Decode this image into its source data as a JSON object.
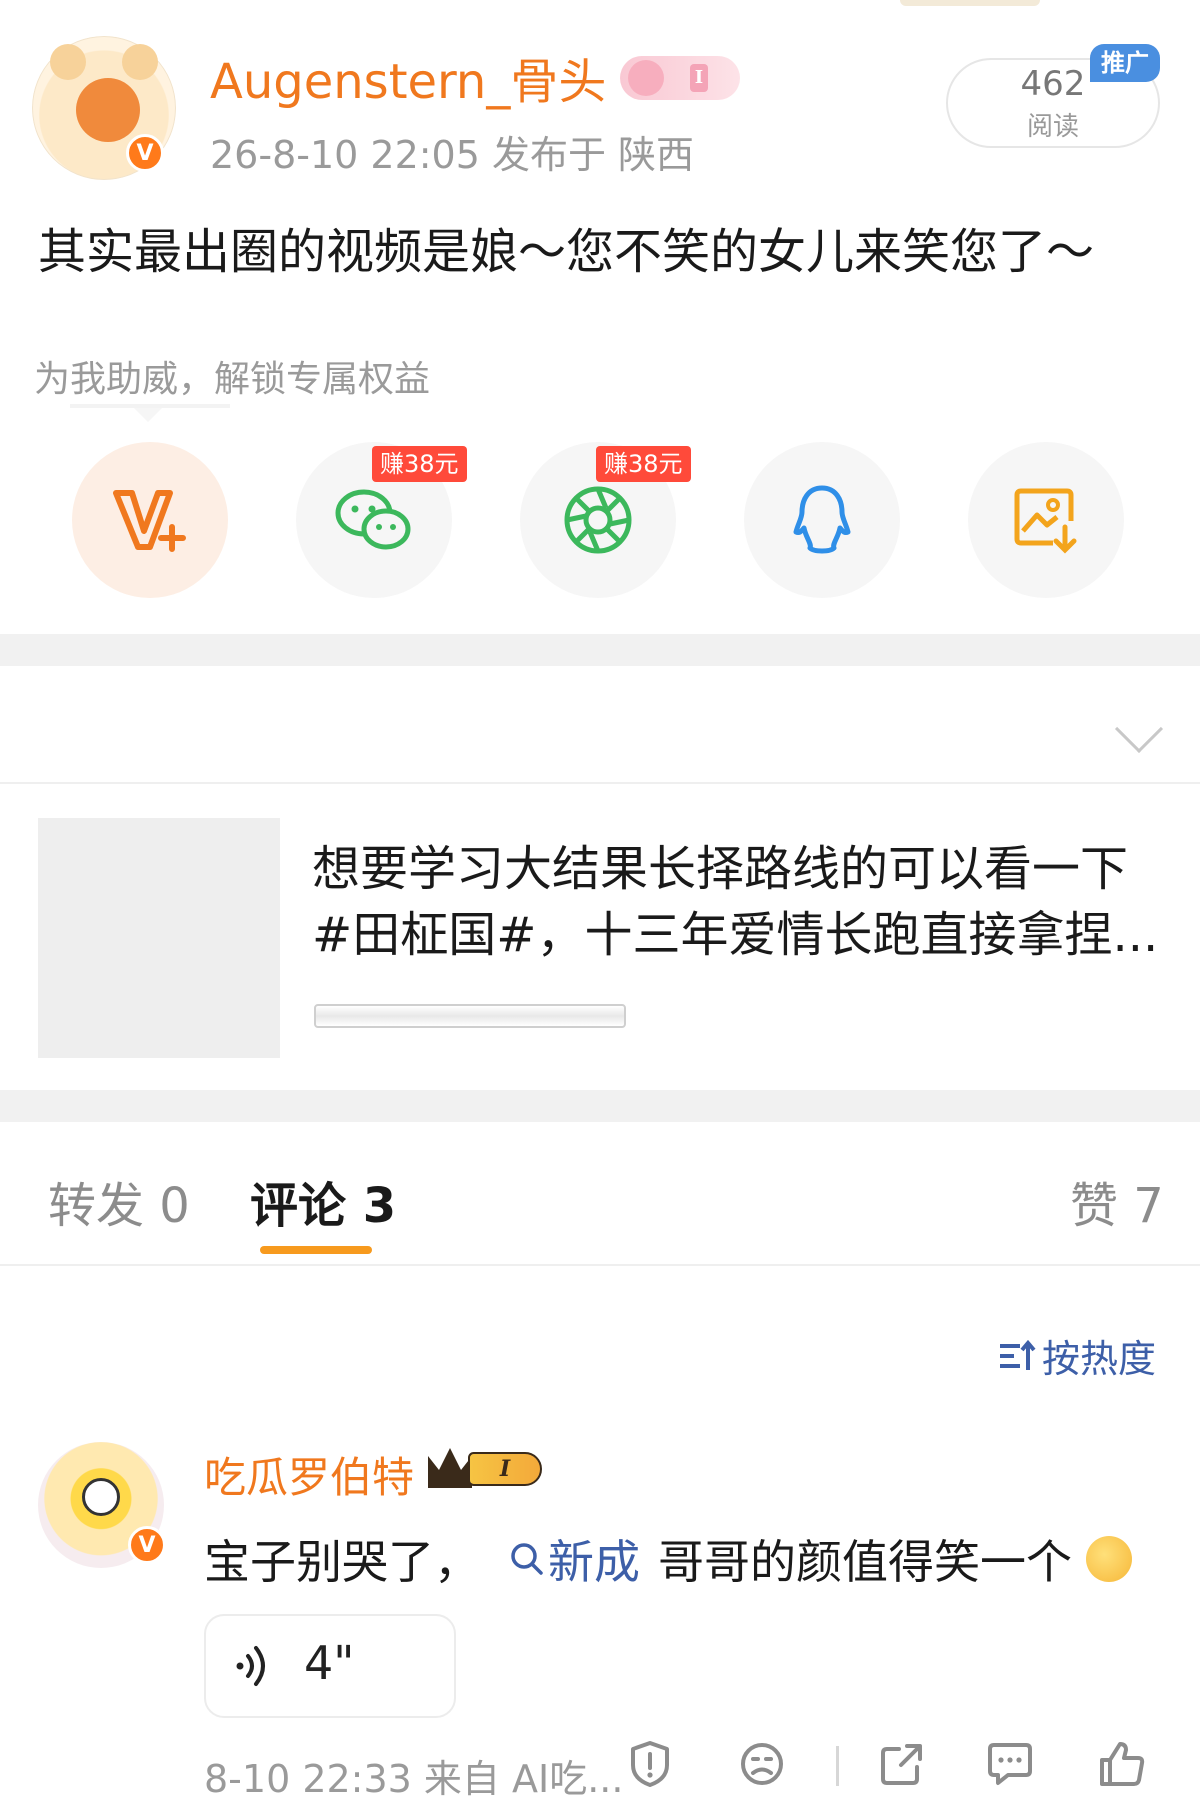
{
  "post": {
    "username": "Augenstern_骨头",
    "meta": "26-8-10 22:05  发布于 陕西",
    "read_count": "462",
    "read_label": "阅读",
    "promo_tag": "推广",
    "text": "其实最出圈的视频是娘～您不笑的女儿来笑您了～",
    "verified_badge": "V"
  },
  "boost": {
    "title": "为我助威，解锁专属权益",
    "earn_wechat": "赚38元",
    "earn_moments": "赚38元",
    "icons": [
      "v-plus-icon",
      "wechat-icon",
      "moments-icon",
      "qq-icon",
      "save-image-icon"
    ]
  },
  "recommend": {
    "title_line1": "想要学习大结果长择路线的可以看一下",
    "title_line2": "#田柾国#，十三年爱情长跑直接拿捏..."
  },
  "tabs": {
    "repost": "转发 0",
    "comment": "评论 3",
    "like": "赞 7"
  },
  "sort": {
    "label": "按热度"
  },
  "comment": {
    "name": "吃瓜罗伯特",
    "level": "I",
    "text_before": "宝子别哭了，",
    "tag": "新成",
    "text_after": "哥哥的颜值得笑一个",
    "voice_length": "4\"",
    "time": "8-10 22:33 来自 AI吃...",
    "verified_badge": "V"
  },
  "colors": {
    "brand_orange": "#f0781e",
    "link_blue": "#3d5fa8",
    "tab_underline": "#f79a1e",
    "earn_red": "#ff4a3a"
  }
}
